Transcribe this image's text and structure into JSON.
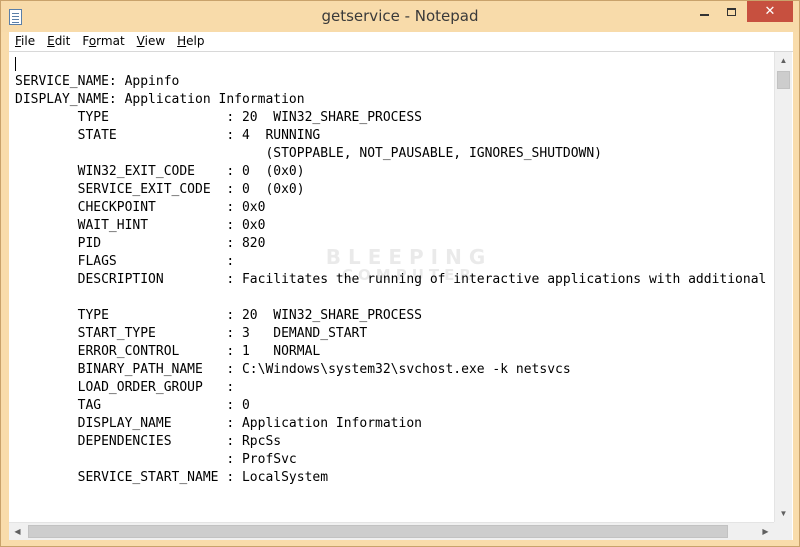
{
  "window": {
    "title": "getservice - Notepad",
    "close_glyph": "✕"
  },
  "menu": [
    {
      "label": "File",
      "mnemonic": "F",
      "rest": "ile"
    },
    {
      "label": "Edit",
      "mnemonic": "E",
      "rest": "dit"
    },
    {
      "label": "Format",
      "mnemonic": "o",
      "prefix": "F",
      "rest": "rmat"
    },
    {
      "label": "View",
      "mnemonic": "V",
      "rest": "iew"
    },
    {
      "label": "Help",
      "mnemonic": "H",
      "rest": "elp"
    }
  ],
  "document": {
    "lines": [
      "",
      "SERVICE_NAME: Appinfo",
      "DISPLAY_NAME: Application Information",
      "        TYPE               : 20  WIN32_SHARE_PROCESS",
      "        STATE              : 4  RUNNING",
      "                                (STOPPABLE, NOT_PAUSABLE, IGNORES_SHUTDOWN)",
      "        WIN32_EXIT_CODE    : 0  (0x0)",
      "        SERVICE_EXIT_CODE  : 0  (0x0)",
      "        CHECKPOINT         : 0x0",
      "        WAIT_HINT          : 0x0",
      "        PID                : 820",
      "        FLAGS              :",
      "        DESCRIPTION        : Facilitates the running of interactive applications with additional",
      "",
      "        TYPE               : 20  WIN32_SHARE_PROCESS",
      "        START_TYPE         : 3   DEMAND_START",
      "        ERROR_CONTROL      : 1   NORMAL",
      "        BINARY_PATH_NAME   : C:\\Windows\\system32\\svchost.exe -k netsvcs",
      "        LOAD_ORDER_GROUP   :",
      "        TAG                : 0",
      "        DISPLAY_NAME       : Application Information",
      "        DEPENDENCIES       : RpcSs",
      "                           : ProfSvc",
      "        SERVICE_START_NAME : LocalSystem"
    ]
  },
  "watermark": {
    "line1": "BLEEPING",
    "line2": "COMPUTER"
  },
  "icons": {
    "app": "notepad-icon",
    "minimize": "minimize-icon",
    "maximize": "maximize-icon",
    "close": "close-icon"
  },
  "colors": {
    "titlebar": "#f8dbaa",
    "close_button": "#c7503f"
  }
}
